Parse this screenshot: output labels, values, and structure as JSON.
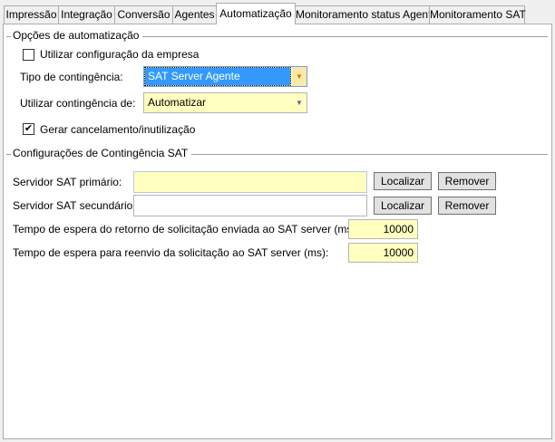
{
  "tabs": [
    {
      "label": "Impressão",
      "active": false
    },
    {
      "label": "Integração",
      "active": false
    },
    {
      "label": "Conversão",
      "active": false
    },
    {
      "label": "Agentes",
      "active": false
    },
    {
      "label": "Automatização",
      "active": true
    },
    {
      "label": "Monitoramento status Agente",
      "active": false
    },
    {
      "label": "Monitoramento SAT",
      "active": false
    }
  ],
  "automation": {
    "group_title": "Opções de automatização",
    "use_company_config": {
      "label": "Utilizar configuração da empresa",
      "checked": false
    },
    "contingency_type": {
      "label": "Tipo de contingência:",
      "value": "SAT Server Agente"
    },
    "use_contingency_from": {
      "label": "Utilizar contingência de:",
      "value": "Automatizar"
    },
    "generate_cancel": {
      "label": "Gerar cancelamento/inutilização",
      "checked": true,
      "mark": "✔"
    }
  },
  "sat": {
    "group_title": "Configurações de Contingência SAT",
    "primary": {
      "label": "Servidor SAT primário:",
      "value": "",
      "locate": "Localizar",
      "remove": "Remover"
    },
    "secondary": {
      "label": "Servidor SAT secundário:",
      "value": "",
      "locate": "Localizar",
      "remove": "Remover"
    },
    "return_timeout": {
      "label": "Tempo de espera do retorno de solicitação enviada ao SAT server (ms):",
      "value": "10000"
    },
    "resend_timeout": {
      "label": "Tempo de espera para reenvio da solicitação ao SAT server (ms):",
      "value": "10000"
    }
  },
  "colors": {
    "highlight": "#3399ff",
    "input_yellow": "#ffffc0"
  }
}
